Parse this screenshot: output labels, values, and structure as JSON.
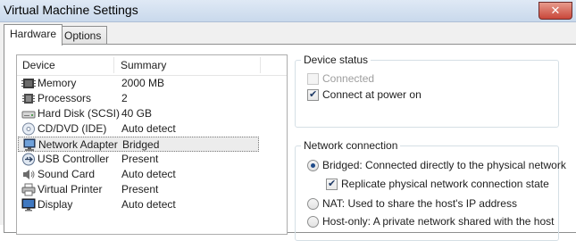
{
  "window": {
    "title": "Virtual Machine Settings",
    "close_glyph": "✕"
  },
  "tabs": [
    {
      "label": "Hardware",
      "active": true
    },
    {
      "label": "Options",
      "active": false
    }
  ],
  "device_list": {
    "columns": [
      "Device",
      "Summary"
    ],
    "items": [
      {
        "device": "Memory",
        "summary": "2000 MB",
        "icon": "memory-icon"
      },
      {
        "device": "Processors",
        "summary": "2",
        "icon": "processor-icon"
      },
      {
        "device": "Hard Disk (SCSI)",
        "summary": "40 GB",
        "icon": "hard-disk-icon"
      },
      {
        "device": "CD/DVD (IDE)",
        "summary": "Auto detect",
        "icon": "cd-dvd-icon"
      },
      {
        "device": "Network Adapter",
        "summary": "Bridged",
        "icon": "network-adapter-icon",
        "selected": true
      },
      {
        "device": "USB Controller",
        "summary": "Present",
        "icon": "usb-icon"
      },
      {
        "device": "Sound Card",
        "summary": "Auto detect",
        "icon": "sound-card-icon"
      },
      {
        "device": "Virtual Printer",
        "summary": "Present",
        "icon": "printer-icon"
      },
      {
        "device": "Display",
        "summary": "Auto detect",
        "icon": "display-icon"
      }
    ]
  },
  "device_status": {
    "legend": "Device status",
    "connected": {
      "label": "Connected",
      "checked": false,
      "enabled": false
    },
    "connect_at_power_on": {
      "label": "Connect at power on",
      "checked": true
    }
  },
  "network_connection": {
    "legend": "Network connection",
    "bridged": {
      "label": "Bridged: Connected directly to the physical network",
      "selected": true
    },
    "replicate": {
      "label": "Replicate physical network connection state",
      "checked": true
    },
    "nat": {
      "label": "NAT: Used to share the host's IP address",
      "selected": false
    },
    "host_only": {
      "label": "Host-only: A private network shared with the host",
      "selected": false
    }
  },
  "colors": {
    "selection": "#ececec",
    "titlebar": "#dfe9f5",
    "close": "#c9473a"
  }
}
